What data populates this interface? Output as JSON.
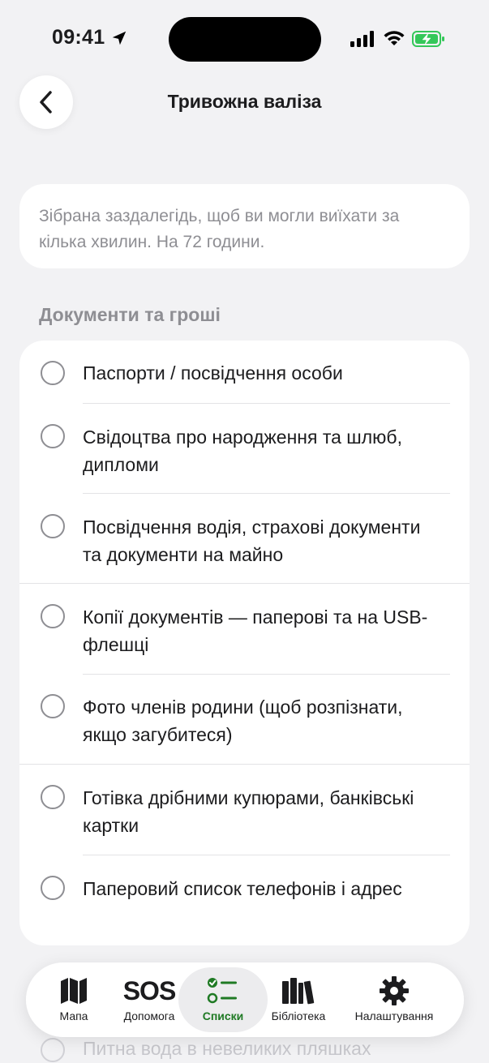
{
  "status_bar": {
    "time": "09:41"
  },
  "header": {
    "title": "Тривожна валіза"
  },
  "intro": {
    "text": "Зібрана заздалегідь, щоб ви могли виїхати за кілька хвилин. На 72 години."
  },
  "section": {
    "title": "Документи та гроші",
    "items": [
      {
        "label": "Паспорти / посвідчення особи",
        "checked": false
      },
      {
        "label": "Свідоцтва про народження та шлюб, дипломи",
        "checked": false
      },
      {
        "label": "Посвідчення водія, страхові документи та документи на майно",
        "checked": false
      },
      {
        "label": "Копії документів — паперові та на USB-флешці",
        "checked": false
      },
      {
        "label": "Фото членів родини (щоб розпізнати, якщо загубитеся)",
        "checked": false
      },
      {
        "label": "Готівка дрібними купюрами, банківські картки",
        "checked": false
      },
      {
        "label": "Паперовий список телефонів і адрес",
        "checked": false
      }
    ]
  },
  "peek_item": {
    "label": "Питна вода в невеликих пляшках"
  },
  "tab_bar": {
    "tabs": [
      {
        "label": "Мапа",
        "icon": "map-icon",
        "active": false
      },
      {
        "label": "Допомога",
        "icon": "sos-icon",
        "icon_text": "SOS",
        "active": false
      },
      {
        "label": "Списки",
        "icon": "checklist-icon",
        "active": true
      },
      {
        "label": "Бібліотека",
        "icon": "library-icon",
        "active": false
      },
      {
        "label": "Налаштування",
        "icon": "gear-icon",
        "active": false
      }
    ]
  },
  "colors": {
    "background": "#f2f2f4",
    "card": "#ffffff",
    "secondary_text": "#8e8e93",
    "accent_green": "#1f7a24",
    "battery_green": "#34c759"
  }
}
